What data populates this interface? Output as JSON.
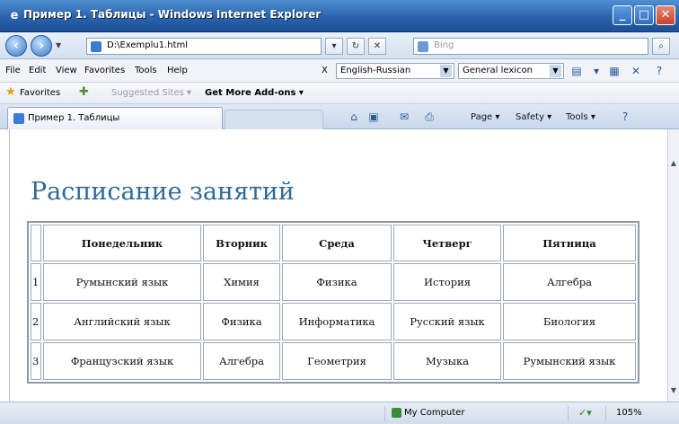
{
  "window": {
    "title": "Пример 1. Таблицы - Windows Internet Explorer",
    "min_label": "_",
    "max_label": "□",
    "close_label": "✕"
  },
  "navbar": {
    "back_icon": "back-arrow-icon",
    "forward_icon": "forward-arrow-icon",
    "address": "D:\\Exemplu1.html",
    "refresh_label": "↻",
    "stop_label": "✕",
    "search_placeholder": "Bing",
    "search_button": "⌕"
  },
  "menu": {
    "items": [
      "File",
      "Edit",
      "View",
      "Favorites",
      "Tools",
      "Help"
    ],
    "translate_close": "X",
    "translation_direction": "English-Russian",
    "dictionary": "General lexicon"
  },
  "favorites": {
    "label": "Favorites",
    "suggested": "Suggested Sites ▾",
    "addons": "Get More Add-ons ▾"
  },
  "tab": {
    "label": "Пример 1. Таблицы",
    "commands": [
      "Page ▾",
      "Safety ▾",
      "Tools ▾"
    ]
  },
  "page": {
    "heading": "Расписание занятий",
    "table": {
      "headers": [
        "",
        "Понедельник",
        "Вторник",
        "Среда",
        "Четверг",
        "Пятница"
      ],
      "rows": [
        {
          "num": "1",
          "cells": [
            "Румынский язык",
            "Химия",
            "Физика",
            "История",
            "Алгебра"
          ]
        },
        {
          "num": "2",
          "cells": [
            "Английский язык",
            "Физика",
            "Информатика",
            "Русский язык",
            "Биология"
          ]
        },
        {
          "num": "3",
          "cells": [
            "Французский язык",
            "Алгебра",
            "Геометрия",
            "Музыка",
            "Румынский язык"
          ]
        }
      ]
    }
  },
  "status": {
    "zone": "My Computer",
    "zoom": "105%"
  },
  "colors": {
    "titlebar": "#2a63ad",
    "heading": "#2f6a96",
    "chrome": "#dfe8f4"
  }
}
